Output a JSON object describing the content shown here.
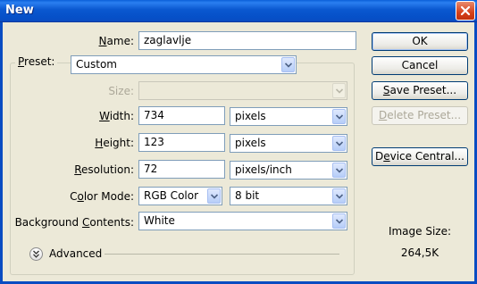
{
  "window": {
    "title": "New"
  },
  "name": {
    "label": "Name:",
    "value": "zaglavlje"
  },
  "preset": {
    "label": "Preset:",
    "value": "Custom"
  },
  "size": {
    "label": "Size:",
    "value": ""
  },
  "width": {
    "label": "Width:",
    "value": "734",
    "unit": "pixels"
  },
  "height": {
    "label": "Height:",
    "value": "123",
    "unit": "pixels"
  },
  "resolution": {
    "label": "Resolution:",
    "value": "72",
    "unit": "pixels/inch"
  },
  "color_mode": {
    "label": "Color Mode:",
    "mode": "RGB Color",
    "depth": "8 bit"
  },
  "background": {
    "label": "Background Contents:",
    "value": "White"
  },
  "advanced": {
    "label": "Advanced"
  },
  "buttons": {
    "ok": "OK",
    "cancel": "Cancel",
    "save_preset": "Save Preset...",
    "delete_preset": "Delete Preset...",
    "device_central": "Device Central..."
  },
  "image_size": {
    "label": "Image Size:",
    "value": "264,5K"
  },
  "icons": {
    "close": "close-icon",
    "dropdown": "chevron-down-icon",
    "advanced": "double-chevron-down-icon"
  }
}
